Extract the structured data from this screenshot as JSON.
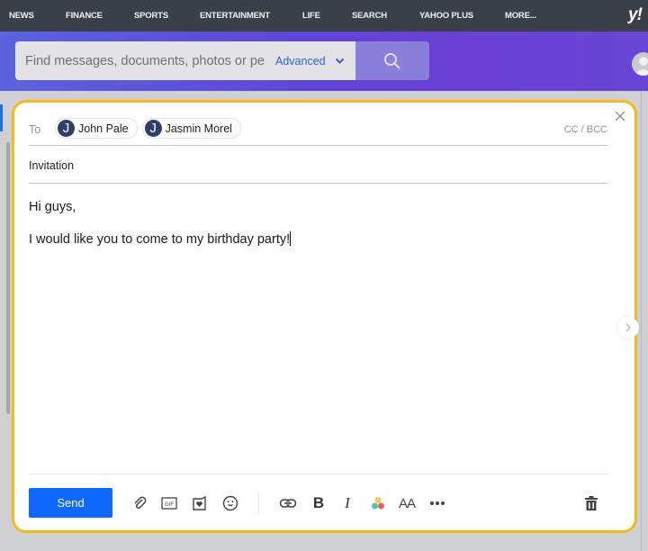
{
  "topnav": {
    "items": [
      "NEWS",
      "FINANCE",
      "SPORTS",
      "ENTERTAINMENT",
      "LIFE",
      "SEARCH",
      "YAHOO PLUS",
      "MORE..."
    ],
    "logo": "y!"
  },
  "search": {
    "placeholder": "Find messages, documents, photos or people",
    "advanced_label": "Advanced",
    "search_icon": "search-icon"
  },
  "compose": {
    "to_label": "To",
    "recipients": [
      {
        "initial": "J",
        "name": "John Pale"
      },
      {
        "initial": "J",
        "name": "Jasmin Morel"
      }
    ],
    "cc_bcc_label": "CC / BCC",
    "subject": "Invitation",
    "body_lines": [
      "Hi guys,",
      "I would like you to come to my birthday party!"
    ],
    "send_label": "Send",
    "toolbar_icons": [
      "attachment-icon",
      "gif-icon",
      "sticker-card-icon",
      "emoji-icon",
      "link-icon",
      "bold-icon",
      "italic-icon",
      "color-icon",
      "font-size-icon",
      "more-icon",
      "delete-icon"
    ],
    "bold_glyph": "B",
    "italic_glyph": "I",
    "font_size_glyph": "AA",
    "more_glyph": "•••"
  },
  "colors": {
    "accent_border": "#f5b91c",
    "send_button": "#0f69ff",
    "nav_background": "#3a3f48",
    "header_gradient_start": "#5b63dd",
    "header_gradient_end": "#6846d5",
    "advanced_link": "#2a61d8"
  }
}
